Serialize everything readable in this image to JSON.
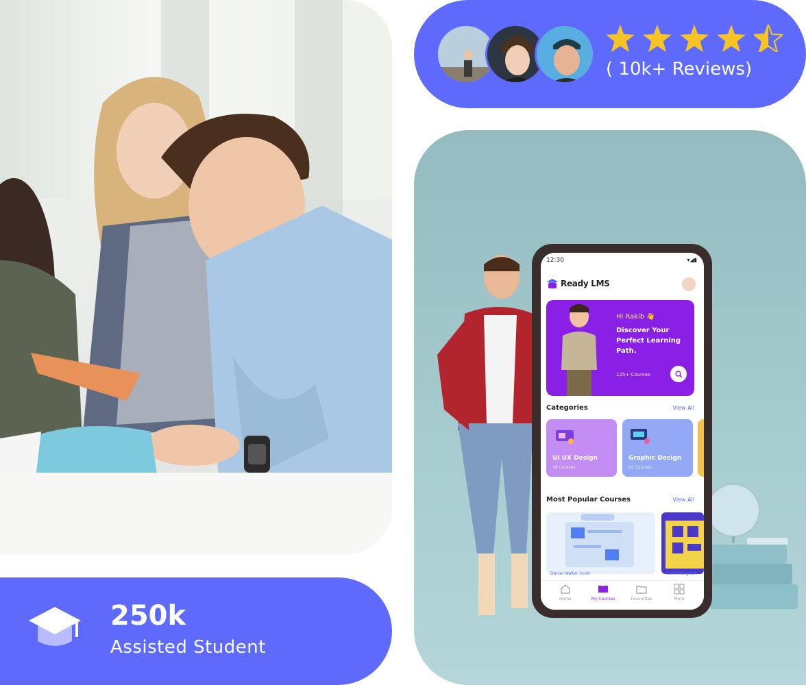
{
  "stats": {
    "number": "250k",
    "label": "Assisted Student"
  },
  "reviews": {
    "text": "( 10k+ Reviews)",
    "rating": 4.5,
    "max": 5
  },
  "phone": {
    "time": "12:30",
    "app_name": "Ready LMS",
    "greeting": "Hi Rakib 👋",
    "hero_title": "Discover Your Perfect Learning Path.",
    "course_count": "125+ Courses",
    "categories_title": "Categories",
    "view_all": "View All",
    "categories": [
      {
        "name": "UI UX Design",
        "count": "16 Courses",
        "color": "#c38cf2"
      },
      {
        "name": "Graphic Design",
        "count": "12 Courses",
        "color": "#93a9f5"
      }
    ],
    "popular_title": "Most Popular Courses",
    "courses": [
      {
        "author": "Daniel Walter Scott"
      },
      {
        "author": "Caleb Kingston"
      }
    ],
    "nav": [
      "Home",
      "My Courses",
      "Favourites",
      "More"
    ]
  },
  "colors": {
    "accent": "#5d6afc",
    "purple": "#8a1fe6",
    "star": "#f7c325"
  }
}
